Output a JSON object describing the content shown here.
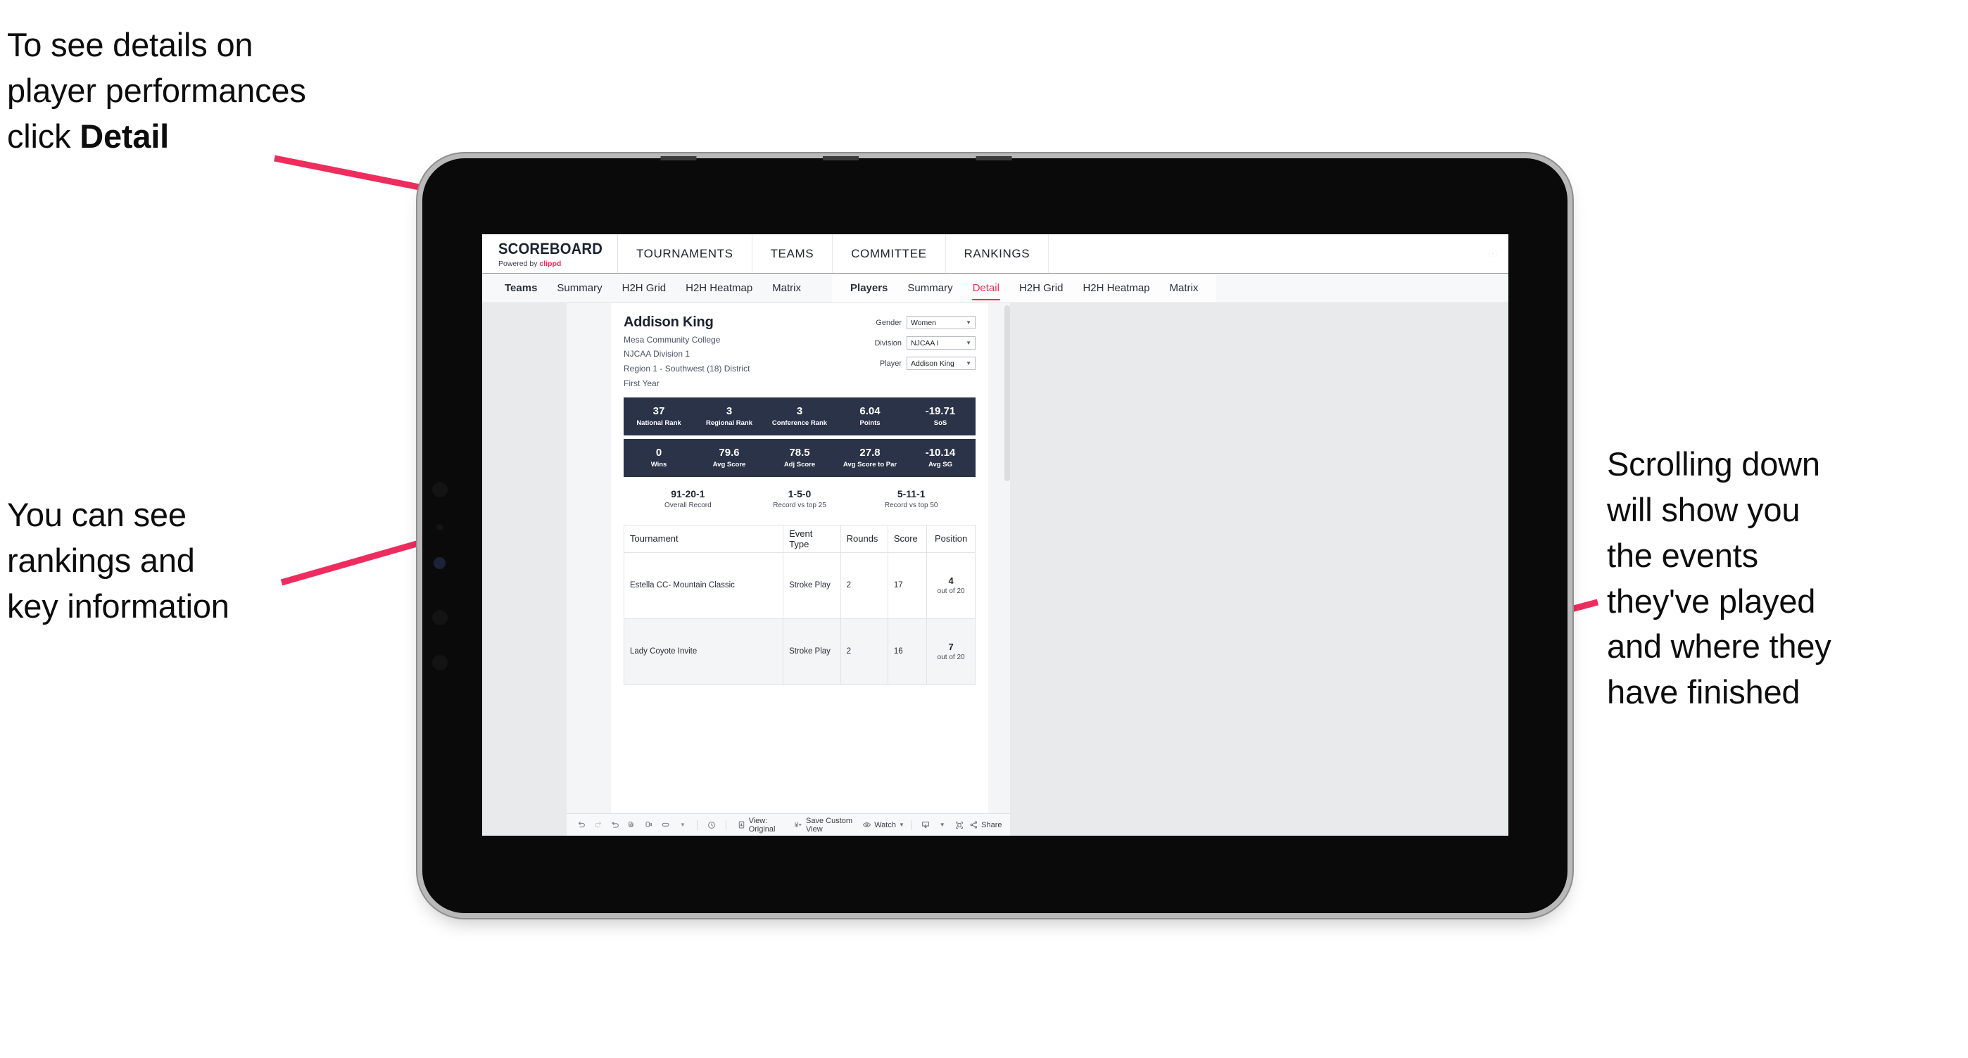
{
  "annotations": {
    "top_left": "To see details on\nplayer performances\nclick ",
    "top_left_bold": "Detail",
    "mid_left": "You can see\nrankings and\nkey information",
    "right": "Scrolling down\nwill show you\nthe events\nthey've played\nand where they\nhave finished",
    "arrow_color": "#ee2d5e"
  },
  "app": {
    "brand": {
      "title": "SCOREBOARD",
      "powered_prefix": "Powered by ",
      "powered_brand": "clippd"
    },
    "top_nav": [
      "TOURNAMENTS",
      "TEAMS",
      "COMMITTEE",
      "RANKINGS"
    ],
    "sub_nav": {
      "group_teams": [
        "Teams",
        "Summary",
        "H2H Grid",
        "H2H Heatmap",
        "Matrix"
      ],
      "group_players": [
        "Players",
        "Summary",
        "Detail",
        "H2H Grid",
        "H2H Heatmap",
        "Matrix"
      ],
      "active": "Detail"
    },
    "accent": "#ef2d56",
    "stat_bar_color": "#2b3349"
  },
  "player": {
    "name": "Addison King",
    "school": "Mesa Community College",
    "division": "NJCAA Division 1",
    "region": "Region 1 - Southwest (18) District",
    "year": "First Year"
  },
  "filters": [
    {
      "label": "Gender",
      "value": "Women"
    },
    {
      "label": "Division",
      "value": "NJCAA I"
    },
    {
      "label": "Player",
      "value": "Addison King"
    }
  ],
  "stats_row_1": [
    {
      "value": "37",
      "label": "National Rank"
    },
    {
      "value": "3",
      "label": "Regional Rank"
    },
    {
      "value": "3",
      "label": "Conference Rank"
    },
    {
      "value": "6.04",
      "label": "Points"
    },
    {
      "value": "-19.71",
      "label": "SoS"
    }
  ],
  "stats_row_2": [
    {
      "value": "0",
      "label": "Wins"
    },
    {
      "value": "79.6",
      "label": "Avg Score"
    },
    {
      "value": "78.5",
      "label": "Adj Score"
    },
    {
      "value": "27.8",
      "label": "Avg Score to Par"
    },
    {
      "value": "-10.14",
      "label": "Avg SG"
    }
  ],
  "records": [
    {
      "value": "91-20-1",
      "label": "Overall Record"
    },
    {
      "value": "1-5-0",
      "label": "Record vs top 25"
    },
    {
      "value": "5-11-1",
      "label": "Record vs top 50"
    }
  ],
  "tournament_table": {
    "headers": [
      "Tournament",
      "Event Type",
      "Rounds",
      "Score",
      "Position"
    ],
    "rows": [
      {
        "tournament": "Estella CC- Mountain Classic",
        "event_type": "Stroke Play",
        "rounds": "2",
        "score": "17",
        "position_value": "4",
        "position_suffix": "out of 20"
      },
      {
        "tournament": "Lady Coyote Invite",
        "event_type": "Stroke Play",
        "rounds": "2",
        "score": "16",
        "position_value": "7",
        "position_suffix": "out of 20"
      }
    ]
  },
  "toolbar": {
    "view_label": "View: Original",
    "save_label": "Save Custom View",
    "watch_label": "Watch",
    "share_label": "Share"
  }
}
